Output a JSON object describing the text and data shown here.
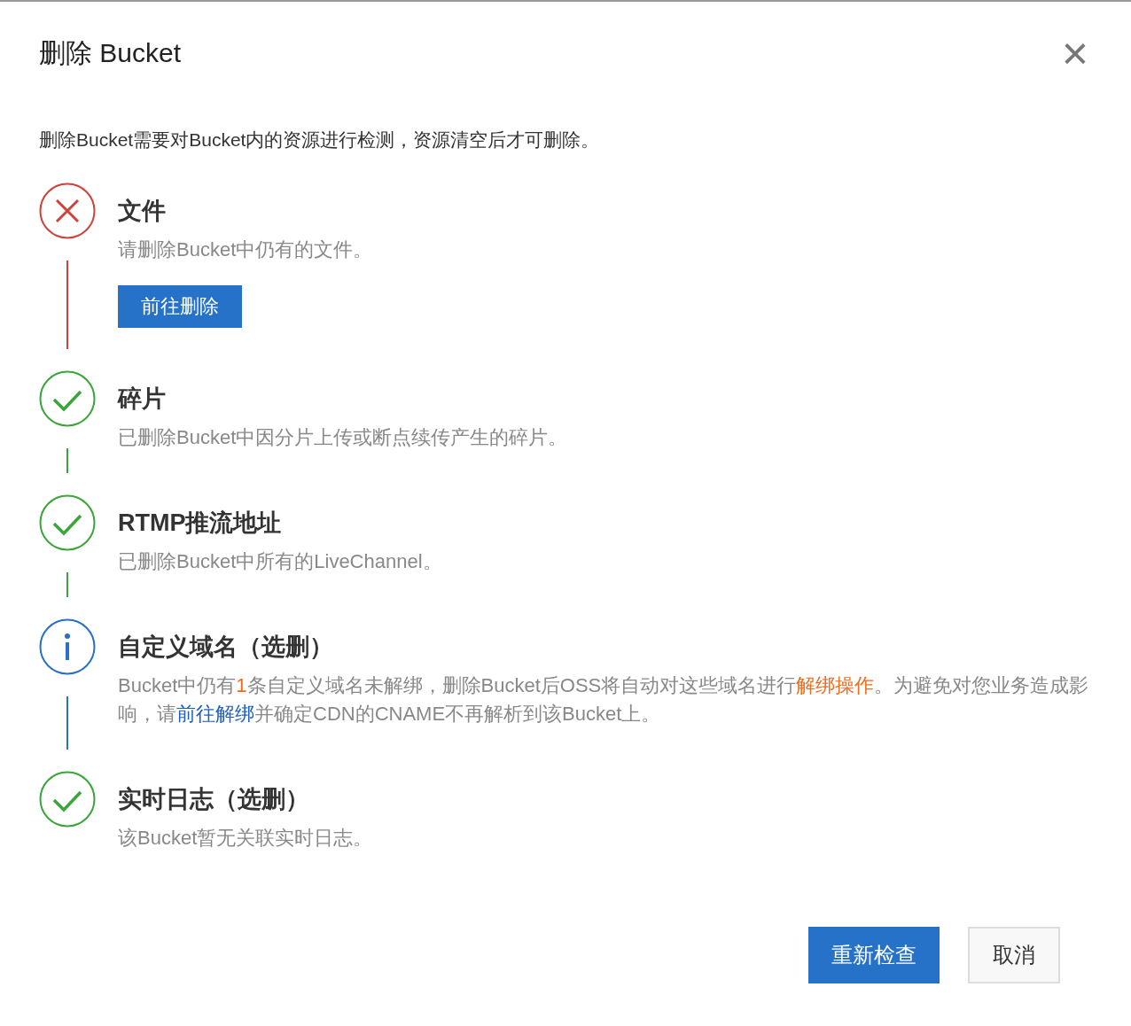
{
  "dialog": {
    "title": "删除 Bucket",
    "close": "×"
  },
  "intro": "删除Bucket需要对Bucket内的资源进行检测，资源清空后才可删除。",
  "steps": [
    {
      "kind": "error",
      "title": "文件",
      "description": [
        {
          "kind": "text",
          "text": "请删除Bucket中仍有的文件。"
        }
      ],
      "action": "前往删除"
    },
    {
      "kind": "success",
      "title": "碎片",
      "description": [
        {
          "kind": "text",
          "text": "已删除Bucket中因分片上传或断点续传产生的碎片。"
        }
      ]
    },
    {
      "kind": "success",
      "title": "RTMP推流地址",
      "description": [
        {
          "kind": "text",
          "text": "已删除Bucket中所有的LiveChannel。"
        }
      ]
    },
    {
      "kind": "info",
      "title": "自定义域名（选删）",
      "description": [
        {
          "kind": "text",
          "text": "Bucket中仍有"
        },
        {
          "kind": "highlight",
          "text": "1"
        },
        {
          "kind": "text",
          "text": "条自定义域名未解绑，删除Bucket后OSS将自动对这些域名进行"
        },
        {
          "kind": "highlight",
          "text": "解绑操作"
        },
        {
          "kind": "text",
          "text": "。为避免对您业务造成影响，请"
        },
        {
          "kind": "link",
          "text": "前往解绑"
        },
        {
          "kind": "text",
          "text": "并确定CDN的CNAME不再解析到该Bucket上。"
        }
      ]
    },
    {
      "kind": "success",
      "title": "实时日志（选删）",
      "description": [
        {
          "kind": "text",
          "text": "该Bucket暂无关联实时日志。"
        }
      ]
    }
  ],
  "buttons": [
    {
      "label": "重新检查",
      "primary": true
    },
    {
      "label": "取消",
      "primary": false
    }
  ]
}
